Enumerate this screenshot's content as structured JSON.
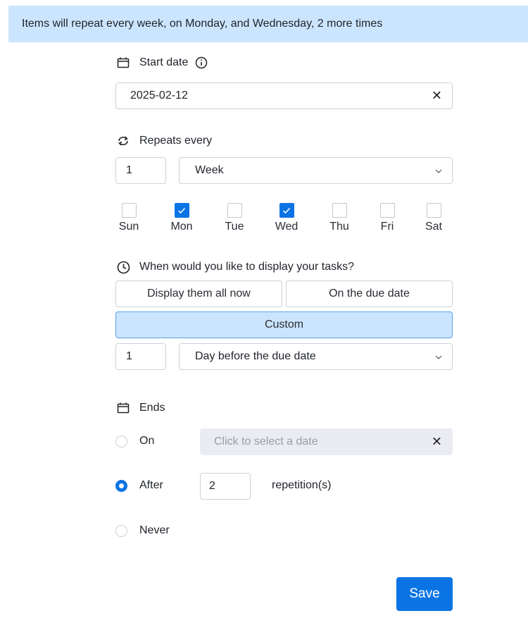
{
  "banner": {
    "text": "Items will repeat every week, on Monday, and Wednesday, 2 more times"
  },
  "start_date": {
    "label": "Start date",
    "icon": "calendar-icon",
    "info_icon": "info-icon",
    "value": "2025-02-12",
    "clear_glyph": "✕"
  },
  "repeats": {
    "label": "Repeats every",
    "icon": "repeat-icon",
    "interval": "1",
    "unit": "Week",
    "days": [
      {
        "label": "Sun",
        "checked": false
      },
      {
        "label": "Mon",
        "checked": true
      },
      {
        "label": "Tue",
        "checked": false
      },
      {
        "label": "Wed",
        "checked": true
      },
      {
        "label": "Thu",
        "checked": false
      },
      {
        "label": "Fri",
        "checked": false
      },
      {
        "label": "Sat",
        "checked": false
      }
    ]
  },
  "display": {
    "label": "When would you like to display your tasks?",
    "icon": "clock-icon",
    "options": [
      "Display them all now",
      "On the due date",
      "Custom"
    ],
    "selected": "Custom",
    "custom_amount": "1",
    "custom_unit": "Day before the due date"
  },
  "ends": {
    "label": "Ends",
    "icon": "calendar-icon",
    "options": [
      {
        "label": "On",
        "checked": false
      },
      {
        "label": "After",
        "checked": true
      },
      {
        "label": "Never",
        "checked": false
      }
    ],
    "on_date_placeholder": "Click to select a date",
    "clear_glyph": "✕",
    "after_count": "2",
    "after_suffix": "repetition(s)"
  },
  "actions": {
    "save_label": "Save"
  },
  "colors": {
    "accent": "#0b74e5",
    "banner_bg": "#cce5ff",
    "selected_bg": "#cce5ff"
  }
}
